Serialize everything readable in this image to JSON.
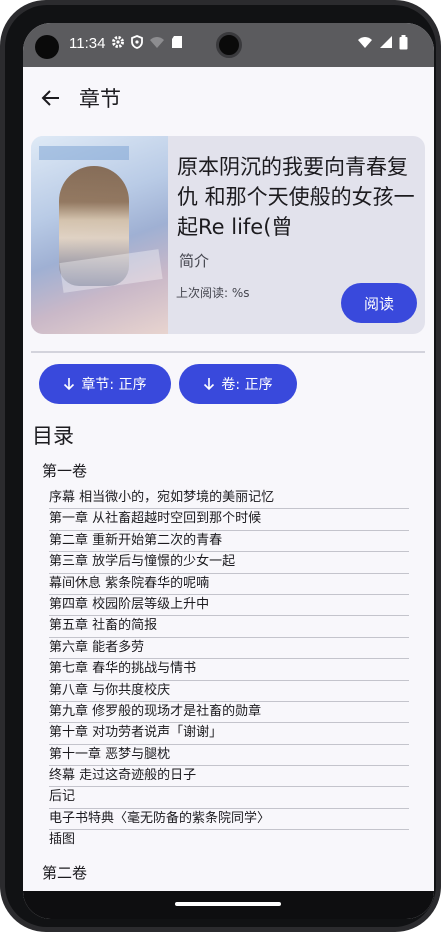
{
  "status_bar": {
    "time": "11:34",
    "icons_left": [
      "gear-icon",
      "shield-icon",
      "wifi-off-icon",
      "sd-card-icon"
    ],
    "icons_right": [
      "wifi-icon",
      "signal-icon",
      "battery-icon"
    ]
  },
  "app_bar": {
    "title": "章节",
    "back_icon": "arrow-left-icon"
  },
  "book": {
    "title": "原本阴沉的我要向青春复仇 和那个天使般的女孩一起Re life(曾",
    "intro_label": "简介",
    "last_read": "上次阅读: %s",
    "read_button": "阅读"
  },
  "sort": {
    "chapter_button": "章节: 正序",
    "volume_button": "卷: 正序",
    "arrow_icon": "arrow-down-icon"
  },
  "toc": {
    "heading": "目录",
    "volumes": [
      {
        "name": "第一卷",
        "chapters": [
          "序幕 相当微小的，宛如梦境的美丽记忆",
          "第一章 从社畜超越时空回到那个时候",
          "第二章 重新开始第二次的青春",
          "第三章 放学后与憧憬的少女一起",
          "幕间休息 紫条院春华的呢喃",
          "第四章 校园阶层等级上升中",
          "第五章 社畜的简报",
          "第六章 能者多劳",
          "第七章 春华的挑战与情书",
          "第八章 与你共度校庆",
          "第九章 修罗般的现场才是社畜的勋章",
          "第十章 对功劳者说声「谢谢」",
          "第十一章 恶梦与腿枕",
          "终幕 走过这奇迹般的日子",
          "后记",
          "电子书特典〈毫无防备的紫条院同学〉",
          "插图"
        ]
      },
      {
        "name": "第二卷",
        "chapters": []
      }
    ]
  },
  "colors": {
    "accent": "#3949dc",
    "card_bg": "#e2e2ec",
    "status_bar_bg": "#5b5b5e"
  }
}
